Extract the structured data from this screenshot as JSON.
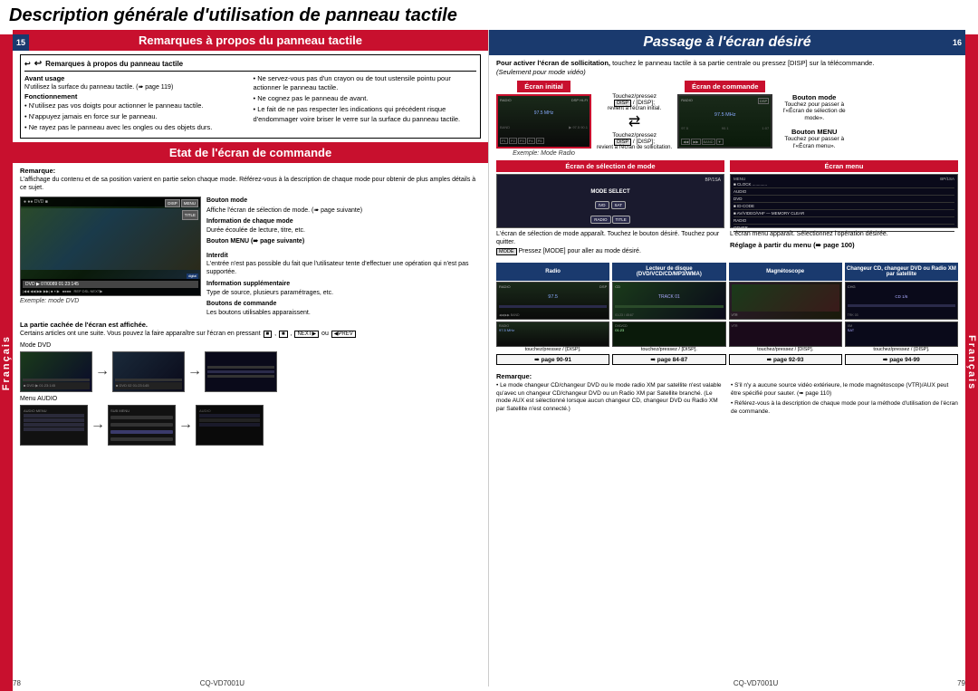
{
  "page": {
    "main_title": "Description générale d'utilisation de panneau tactile",
    "side_label_left": "Français",
    "side_label_right": "Français",
    "page_num_left": "78",
    "page_num_right": "79",
    "model": "CQ-VD7001U",
    "left_section_num": "15",
    "right_section_num": "16"
  },
  "left_panel": {
    "section1": {
      "header": "Remarques à propos du panneau tactile",
      "title_with_arrow": "↩ Remarques à propos du panneau tactile",
      "col1": {
        "avant_usage_label": "Avant usage",
        "avant_usage_text": "N'utilisez la surface du panneau tactile. (➠ page 119)",
        "fonctionnement_label": "Fonctionnement",
        "items": [
          "N'utilisez pas vos doigts pour actionner le panneau tactile.",
          "N'appuyez jamais en force sur le panneau.",
          "Ne rayez pas le panneau avec les ongles ou des objets durs."
        ]
      },
      "col2": {
        "items": [
          "Ne servez-vous pas d'un crayon ou de tout ustensile pointu pour actionner le panneau tactile.",
          "Ne cognez pas le panneau de avant.",
          "Le fait de ne pas respecter les indications qui précédent risque d'endommager voire briser le verre sur la surface du panneau tactile."
        ]
      }
    },
    "section2": {
      "header": "Etat de l'écran de commande",
      "remarque_label": "Remarque:",
      "remarque_text": "L'affichage du contenu et de sa position varient en partie selon chaque mode. Référez-vous à la description de chaque mode pour obtenir de plus amples détails à ce sujet.",
      "bouton_mode_label": "Bouton mode",
      "bouton_mode_desc": "Affiche l'écran de sélection de mode. (➠ page suivante)",
      "info_mode_label": "Information de chaque mode",
      "info_mode_desc": "Durée écoulée de lecture, titre, etc.",
      "bouton_menu_label": "Bouton MENU (➠ page suivante)",
      "interdit_label": "Interdit",
      "interdit_desc": "L'entrée n'est pas possible du fait que l'utilisateur tente d'effectuer une opération qui n'est pas supportée.",
      "info_supp_label": "Information supplémentaire",
      "info_supp_desc": "Type de source, plusieurs paramétrages, etc.",
      "boutons_cmd_label": "Boutons de commande",
      "boutons_cmd_desc": "Les boutons utilisables apparaissent.",
      "exemple_dvd": "Exemple: mode DVD",
      "hidden_label": "La partie cachée de l'écran est affichée.",
      "hidden_desc": "Certains articles ont une suite. Vous pouvez la faire apparaître sur l'écran en pressant",
      "hidden_keys": "■, ■, NEXT ou",
      "mode_dvd": "Mode DVD",
      "menu_audio": "Menu AUDIO"
    }
  },
  "right_panel": {
    "section_header": "Passage à l'écran désiré",
    "instruction_bold": "Pour activer l'écran de sollicitation,",
    "instruction_rest": " touchez le panneau tactile à sa partie centrale ou pressez [DISP] sur la télécommande.",
    "seulement": "(Seulement pour mode vidéo)",
    "ecran_initial_label": "Écran initial",
    "ecran_commande_label": "Écran de commande",
    "exemple_radio": "Exemple: Mode Radio",
    "touchez_pressez_1": "Touchez/pressez",
    "disp_1": "[DISP];",
    "revient_ecran_initial": "revient à l'écran initial.",
    "touchez_pressez_2": "Touchez/pressez",
    "disp_2": "[DISP];",
    "revient_ecran_sollic": "revient à l'écran de sollicitation.",
    "bouton_mode_label": "Bouton mode",
    "bouton_menu_label": "Bouton MENU",
    "bouton_mode_desc": "Touchez pour passer à l'«Écran de sélection de mode».",
    "bouton_menu_desc": "Touchez pour passer à l'«Écran menu».",
    "ecran_selection_label": "Écran de sélection de mode",
    "ecran_menu_label": "Écran menu",
    "selection_caption": "L'écran de sélection de mode apparaît. Touchez le bouton désiré. Touchez pour quitter.",
    "menu_caption": "L'écran menu apparaît. Sélectionnez l'opération désirée.",
    "pressez_mode": "Pressez [MODE] pour aller au mode désiré.",
    "reglage_label": "Réglage à partir du menu",
    "reglage_page": "(➠ page 100)",
    "radio_header": "Radio",
    "lecteur_header": "Lecteur de disque (DVD/VCD/CD/MP3/WMA)",
    "magneto_header": "Magnétoscope",
    "changeur_header": "Changeur CD, changeur DVD ou Radio XM par satellite",
    "radio_caption": "touchez/pressez / [DISP].",
    "lecteur_caption": "touchez/pressez / [DISP].",
    "magneto_caption": "touchez/pressez / [DISP].",
    "changeur_caption": "touchez/pressez / [DISP].",
    "radio_page": "➠ page 90-91",
    "lecteur_page": "➠ page 84-87",
    "magneto_page": "➠ page 92-93",
    "changeur_page": "➠ page 94-99",
    "remark1": "Le mode changeur CD/changeur DVD ou le mode radio XM par satellite n'est valable qu'avec un changeur CD/changeur DVD ou un Radio XM par Satellite branché. (Le mode AUX est sélectionné lorsque aucun changeur CD, changeur DVD ou Radio XM par Satellite n'est connecté.)",
    "remark2": "S'il n'y a aucune source vidéo extérieure, le mode magnétoscope (VTR)/AUX peut être spécifié pour sauter. (➠ page 110)",
    "remark3": "Référez-vous à la description de chaque mode pour la méthode d'utilisation de l'écran de commande."
  }
}
